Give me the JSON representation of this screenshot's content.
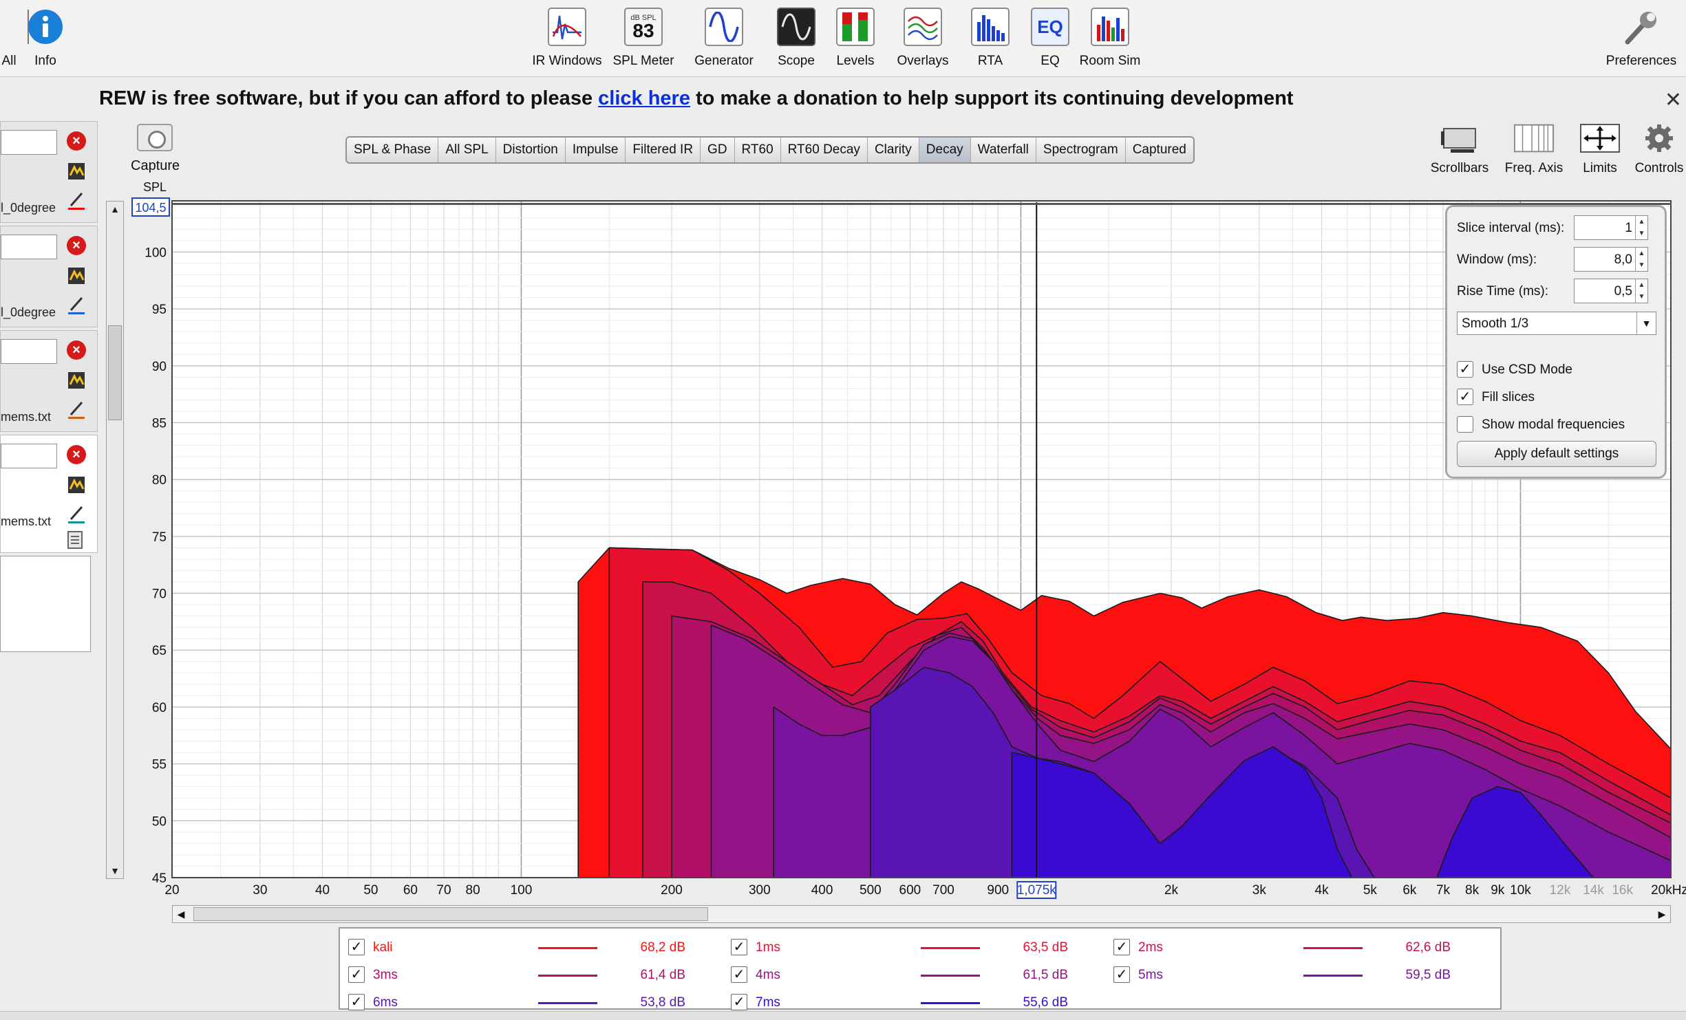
{
  "toolbar": {
    "left_items": [
      {
        "label": "All",
        "icon": "all-icon"
      },
      {
        "label": "Info",
        "icon": "info-icon"
      }
    ],
    "center_items": [
      {
        "label": "IR Windows",
        "icon": "ir-windows-icon"
      },
      {
        "label": "SPL Meter",
        "icon": "spl-meter-icon",
        "badge_top": "dB SPL",
        "badge_value": "83"
      },
      {
        "label": "Generator",
        "icon": "generator-icon"
      },
      {
        "label": "Scope",
        "icon": "scope-icon"
      },
      {
        "label": "Levels",
        "icon": "levels-icon"
      },
      {
        "label": "Overlays",
        "icon": "overlays-icon"
      },
      {
        "label": "RTA",
        "icon": "rta-icon"
      },
      {
        "label": "EQ",
        "icon": "eq-icon"
      },
      {
        "label": "Room Sim",
        "icon": "room-sim-icon"
      }
    ],
    "right_item": {
      "label": "Preferences",
      "icon": "wrench-icon"
    }
  },
  "banner": {
    "before": "REW is free software, but if you can afford to please ",
    "link": "click here",
    "after": " to make a donation to help support its continuing development",
    "close": "✕"
  },
  "measurements": [
    {
      "filename": "l_0degree",
      "color": "#e01010"
    },
    {
      "filename": "l_0degree",
      "color": "#2060d0"
    },
    {
      "filename": "mems.txt",
      "color": "#d06010"
    },
    {
      "filename": "mems.txt",
      "color": "#109090"
    }
  ],
  "capture": {
    "label": "Capture"
  },
  "tabs": [
    "SPL & Phase",
    "All SPL",
    "Distortion",
    "Impulse",
    "Filtered IR",
    "GD",
    "RT60",
    "RT60 Decay",
    "Clarity",
    "Decay",
    "Waterfall",
    "Spectrogram",
    "Captured"
  ],
  "active_tab": "Decay",
  "view_buttons": [
    {
      "label": "Scrollbars",
      "icon": "scrollbars-icon"
    },
    {
      "label": "Freq. Axis",
      "icon": "freq-axis-icon"
    },
    {
      "label": "Limits",
      "icon": "limits-icon"
    },
    {
      "label": "Controls",
      "icon": "gear-icon"
    }
  ],
  "graph": {
    "y_axis_label": "SPL",
    "y_top_readout": "104,5",
    "cursor_readout": "1,075k"
  },
  "controls": {
    "slice_interval": {
      "label": "Slice interval (ms):",
      "value": "1"
    },
    "window": {
      "label": "Window (ms):",
      "value": "8,0"
    },
    "rise_time": {
      "label": "Rise Time (ms):",
      "value": "0,5"
    },
    "smoothing": "Smooth 1/3",
    "use_csd": {
      "label": "Use CSD Mode",
      "checked": true
    },
    "fill_slices": {
      "label": "Fill slices",
      "checked": true
    },
    "show_modal": {
      "label": "Show modal frequencies",
      "checked": false
    },
    "apply_label": "Apply default settings"
  },
  "legend": [
    {
      "name": "kali",
      "value": "68,2 dB",
      "color": "#ff1010"
    },
    {
      "name": "1ms",
      "value": "63,5 dB",
      "color": "#e8102c"
    },
    {
      "name": "2ms",
      "value": "62,6 dB",
      "color": "#c8104a"
    },
    {
      "name": "3ms",
      "value": "61,4 dB",
      "color": "#b01066"
    },
    {
      "name": "4ms",
      "value": "61,5 dB",
      "color": "#941488"
    },
    {
      "name": "5ms",
      "value": "59,5 dB",
      "color": "#7a14a0"
    },
    {
      "name": "6ms",
      "value": "53,8 dB",
      "color": "#5a14b4"
    },
    {
      "name": "7ms",
      "value": "55,6 dB",
      "color": "#3a0ad0"
    }
  ],
  "chart_data": {
    "type": "area",
    "title": "",
    "xlabel": "",
    "ylabel": "SPL",
    "x_scale": "log",
    "xlim": [
      20,
      20000
    ],
    "ylim": [
      45,
      104.5
    ],
    "x_ticks": [
      "20",
      "30",
      "40",
      "50",
      "60",
      "70",
      "80",
      "100",
      "200",
      "300",
      "400",
      "500",
      "600",
      "700",
      "900",
      "1,075k",
      "2k",
      "3k",
      "4k",
      "5k",
      "6k",
      "7k",
      "8k",
      "9k",
      "10k",
      "12k",
      "14k",
      "16k",
      "20kHz"
    ],
    "y_ticks": [
      "45",
      "50",
      "55",
      "60",
      "65",
      "70",
      "75",
      "80",
      "85",
      "90",
      "95",
      "100",
      "104,5"
    ],
    "grid": true,
    "cursor_hz": 1075,
    "series": [
      {
        "name": "kali",
        "start_hz": 130,
        "points": [
          [
            130,
            71
          ],
          [
            150,
            74
          ],
          [
            180,
            73.9
          ],
          [
            220,
            73.8
          ],
          [
            260,
            72.2
          ],
          [
            300,
            71.2
          ],
          [
            340,
            70
          ],
          [
            380,
            70.7
          ],
          [
            440,
            71.3
          ],
          [
            500,
            70.8
          ],
          [
            560,
            69
          ],
          [
            620,
            68.1
          ],
          [
            700,
            70
          ],
          [
            760,
            71
          ],
          [
            820,
            70.4
          ],
          [
            900,
            69.5
          ],
          [
            1000,
            68.5
          ],
          [
            1100,
            69.8
          ],
          [
            1250,
            69.3
          ],
          [
            1400,
            68
          ],
          [
            1600,
            69.2
          ],
          [
            1900,
            70
          ],
          [
            2100,
            69.6
          ],
          [
            2300,
            68.7
          ],
          [
            2600,
            69.7
          ],
          [
            3000,
            70.3
          ],
          [
            3400,
            69.7
          ],
          [
            3900,
            68.3
          ],
          [
            4400,
            67.6
          ],
          [
            4800,
            67.9
          ],
          [
            5400,
            67.6
          ],
          [
            6200,
            67.8
          ],
          [
            7000,
            68.3
          ],
          [
            8000,
            68
          ],
          [
            9500,
            67.4
          ],
          [
            11000,
            67
          ],
          [
            13000,
            65.8
          ],
          [
            15000,
            63
          ],
          [
            17000,
            59.6
          ],
          [
            20000,
            56.3
          ]
        ]
      },
      {
        "name": "1ms",
        "start_hz": 150,
        "points": [
          [
            150,
            74
          ],
          [
            180,
            73.9
          ],
          [
            220,
            73.8
          ],
          [
            260,
            72
          ],
          [
            300,
            70
          ],
          [
            360,
            67
          ],
          [
            420,
            63.5
          ],
          [
            480,
            64
          ],
          [
            540,
            66.5
          ],
          [
            620,
            67.7
          ],
          [
            700,
            67.8
          ],
          [
            780,
            68.2
          ],
          [
            860,
            66
          ],
          [
            960,
            63
          ],
          [
            1100,
            61
          ],
          [
            1250,
            60.3
          ],
          [
            1400,
            59
          ],
          [
            1600,
            61
          ],
          [
            1900,
            64
          ],
          [
            2100,
            62.5
          ],
          [
            2400,
            60.5
          ],
          [
            2800,
            62
          ],
          [
            3200,
            63.5
          ],
          [
            3700,
            62.3
          ],
          [
            4300,
            60.3
          ],
          [
            5000,
            61
          ],
          [
            6000,
            62.3
          ],
          [
            7000,
            62
          ],
          [
            8500,
            60.5
          ],
          [
            10000,
            58.8
          ],
          [
            12000,
            57.5
          ],
          [
            15000,
            55
          ],
          [
            20000,
            52
          ]
        ]
      },
      {
        "name": "2ms",
        "start_hz": 175,
        "points": [
          [
            175,
            71
          ],
          [
            200,
            71
          ],
          [
            240,
            70
          ],
          [
            290,
            67
          ],
          [
            340,
            64
          ],
          [
            400,
            62
          ],
          [
            460,
            61
          ],
          [
            520,
            63
          ],
          [
            600,
            65.2
          ],
          [
            680,
            66.3
          ],
          [
            760,
            67.5
          ],
          [
            840,
            65.8
          ],
          [
            920,
            63
          ],
          [
            1050,
            60
          ],
          [
            1200,
            58.8
          ],
          [
            1400,
            57.8
          ],
          [
            1650,
            59.2
          ],
          [
            1900,
            61
          ],
          [
            2100,
            60.5
          ],
          [
            2400,
            59
          ],
          [
            2800,
            60.5
          ],
          [
            3200,
            61.8
          ],
          [
            3700,
            60.5
          ],
          [
            4300,
            58.7
          ],
          [
            5000,
            59.5
          ],
          [
            6000,
            60.5
          ],
          [
            7000,
            60
          ],
          [
            8500,
            58.5
          ],
          [
            10000,
            57
          ],
          [
            12000,
            56
          ],
          [
            15000,
            53.5
          ],
          [
            20000,
            50.5
          ]
        ]
      },
      {
        "name": "3ms",
        "start_hz": 200,
        "points": [
          [
            200,
            68
          ],
          [
            240,
            67.5
          ],
          [
            290,
            66
          ],
          [
            340,
            64
          ],
          [
            400,
            62
          ],
          [
            460,
            60.2
          ],
          [
            520,
            61
          ],
          [
            600,
            64
          ],
          [
            680,
            66.3
          ],
          [
            760,
            67
          ],
          [
            840,
            65.2
          ],
          [
            920,
            62.8
          ],
          [
            1050,
            59.8
          ],
          [
            1200,
            58.2
          ],
          [
            1400,
            57.3
          ],
          [
            1650,
            58.7
          ],
          [
            1900,
            60.8
          ],
          [
            2100,
            60
          ],
          [
            2400,
            58.5
          ],
          [
            2800,
            60
          ],
          [
            3200,
            61.2
          ],
          [
            3700,
            60
          ],
          [
            4300,
            58
          ],
          [
            5000,
            58.8
          ],
          [
            6000,
            59.7
          ],
          [
            7000,
            59.3
          ],
          [
            8500,
            57.8
          ],
          [
            10000,
            56.2
          ],
          [
            12000,
            55
          ],
          [
            15000,
            52.5
          ],
          [
            20000,
            49.8
          ]
        ]
      },
      {
        "name": "4ms",
        "start_hz": 240,
        "points": [
          [
            240,
            67.2
          ],
          [
            280,
            66
          ],
          [
            330,
            64
          ],
          [
            380,
            62
          ],
          [
            440,
            60.2
          ],
          [
            500,
            59.5
          ],
          [
            560,
            62
          ],
          [
            640,
            65.5
          ],
          [
            720,
            66.5
          ],
          [
            800,
            66
          ],
          [
            880,
            64
          ],
          [
            960,
            61.5
          ],
          [
            1080,
            59
          ],
          [
            1200,
            57.5
          ],
          [
            1400,
            56.8
          ],
          [
            1650,
            58
          ],
          [
            1900,
            60.2
          ],
          [
            2100,
            59.5
          ],
          [
            2400,
            57.8
          ],
          [
            2800,
            59.5
          ],
          [
            3200,
            60.3
          ],
          [
            3700,
            59
          ],
          [
            4300,
            57.2
          ],
          [
            5000,
            57.8
          ],
          [
            6000,
            58.5
          ],
          [
            7000,
            58
          ],
          [
            8500,
            56.5
          ],
          [
            10000,
            55
          ],
          [
            12000,
            53.8
          ],
          [
            15000,
            51.5
          ],
          [
            20000,
            48.5
          ]
        ]
      },
      {
        "name": "5ms",
        "start_hz": 320,
        "points": [
          [
            320,
            60
          ],
          [
            360,
            58.5
          ],
          [
            400,
            57.5
          ],
          [
            440,
            57.5
          ],
          [
            500,
            58.2
          ],
          [
            560,
            61.5
          ],
          [
            640,
            65
          ],
          [
            720,
            66.2
          ],
          [
            800,
            65.8
          ],
          [
            880,
            64
          ],
          [
            960,
            61.5
          ],
          [
            1080,
            58.5
          ],
          [
            1200,
            56.2
          ],
          [
            1400,
            55.2
          ],
          [
            1650,
            57
          ],
          [
            1900,
            59.8
          ],
          [
            2100,
            58.8
          ],
          [
            2400,
            56.5
          ],
          [
            2800,
            58.2
          ],
          [
            3200,
            59.5
          ],
          [
            3700,
            57.5
          ],
          [
            4300,
            55
          ],
          [
            5000,
            55.8
          ],
          [
            6000,
            56.8
          ],
          [
            7000,
            56.2
          ],
          [
            8500,
            54.5
          ],
          [
            10000,
            52.8
          ],
          [
            12000,
            51.3
          ],
          [
            15000,
            49
          ],
          [
            20000,
            46.5
          ]
        ]
      },
      {
        "name": "6ms",
        "start_hz": 500,
        "points": [
          [
            500,
            60
          ],
          [
            560,
            61.5
          ],
          [
            640,
            63.5
          ],
          [
            720,
            63
          ],
          [
            800,
            61.8
          ],
          [
            880,
            59.5
          ],
          [
            960,
            56.5
          ],
          [
            1080,
            55.5
          ],
          [
            1200,
            55.2
          ],
          [
            1400,
            54.2
          ],
          [
            1650,
            51.5
          ],
          [
            1900,
            48
          ],
          [
            2100,
            49.5
          ],
          [
            2400,
            52
          ],
          [
            2800,
            55
          ],
          [
            3200,
            56.3
          ],
          [
            3700,
            54.8
          ],
          [
            4300,
            52
          ],
          [
            4700,
            47.5
          ],
          [
            5100,
            45
          ]
        ]
      },
      {
        "name": "7ms",
        "start_hz": 960,
        "points": [
          [
            960,
            56
          ],
          [
            1080,
            55.5
          ],
          [
            1200,
            55
          ],
          [
            1400,
            54.2
          ],
          [
            1650,
            51.5
          ],
          [
            1900,
            48
          ],
          [
            2100,
            49.5
          ],
          [
            2400,
            52.3
          ],
          [
            2800,
            55.3
          ],
          [
            3200,
            56.5
          ],
          [
            3700,
            54.6
          ],
          [
            4000,
            52
          ],
          [
            4300,
            47.5
          ],
          [
            4600,
            45
          ],
          [
            6800,
            45
          ],
          [
            7300,
            48.5
          ],
          [
            8000,
            52
          ],
          [
            9000,
            53
          ],
          [
            10000,
            52.5
          ],
          [
            11000,
            50.5
          ],
          [
            12500,
            47.5
          ],
          [
            14000,
            45
          ]
        ]
      }
    ]
  }
}
